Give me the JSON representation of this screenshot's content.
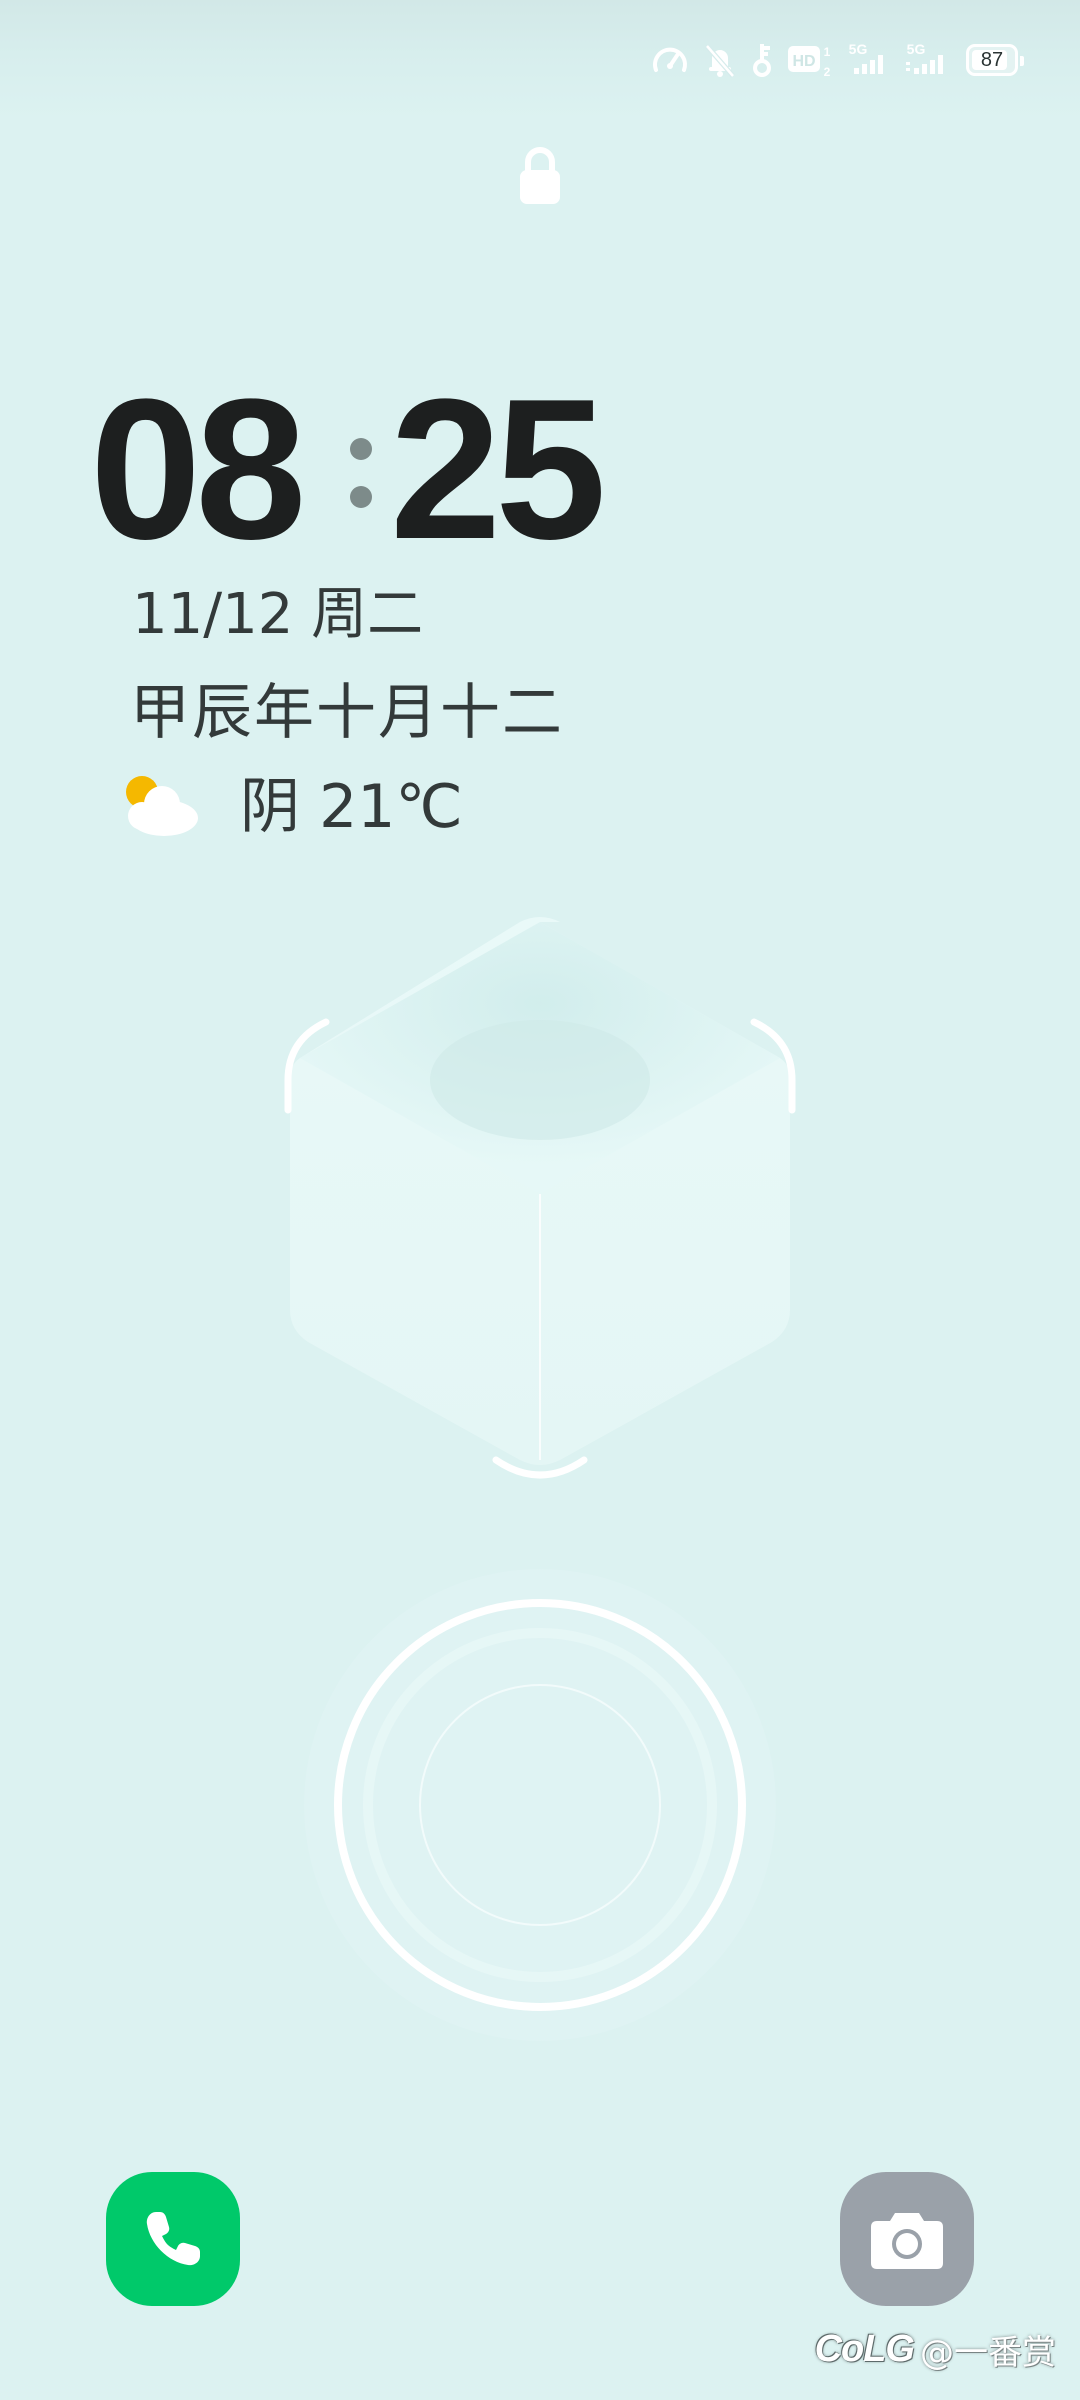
{
  "status_bar": {
    "battery_level": "87",
    "icons": [
      "speedometer-icon",
      "bell-muted-icon",
      "key-icon",
      "hd-volte-icon",
      "signal-5g-icon",
      "signal-5g-icon"
    ],
    "network_label_1": "5G",
    "network_label_2": "5G",
    "hd_label": "HD",
    "hd_sub": "2",
    "sim1_label": "1",
    "sim2_label": "2"
  },
  "lock_screen": {
    "hours": "08",
    "minutes": "25",
    "date": "11/12 周二",
    "lunar_date": "甲辰年十月十二",
    "weather": {
      "icon": "partly-cloudy-icon",
      "text": "阴 21℃"
    }
  },
  "shortcuts": {
    "left": "phone-icon",
    "right": "camera-icon"
  },
  "watermark": {
    "logo": "CoLG",
    "handle": "@一番赏"
  },
  "colors": {
    "background": "#dcf2f1",
    "phone_button": "#00c96a",
    "camera_button": "#9aa1a9",
    "clock_text": "#1d1f1f"
  }
}
